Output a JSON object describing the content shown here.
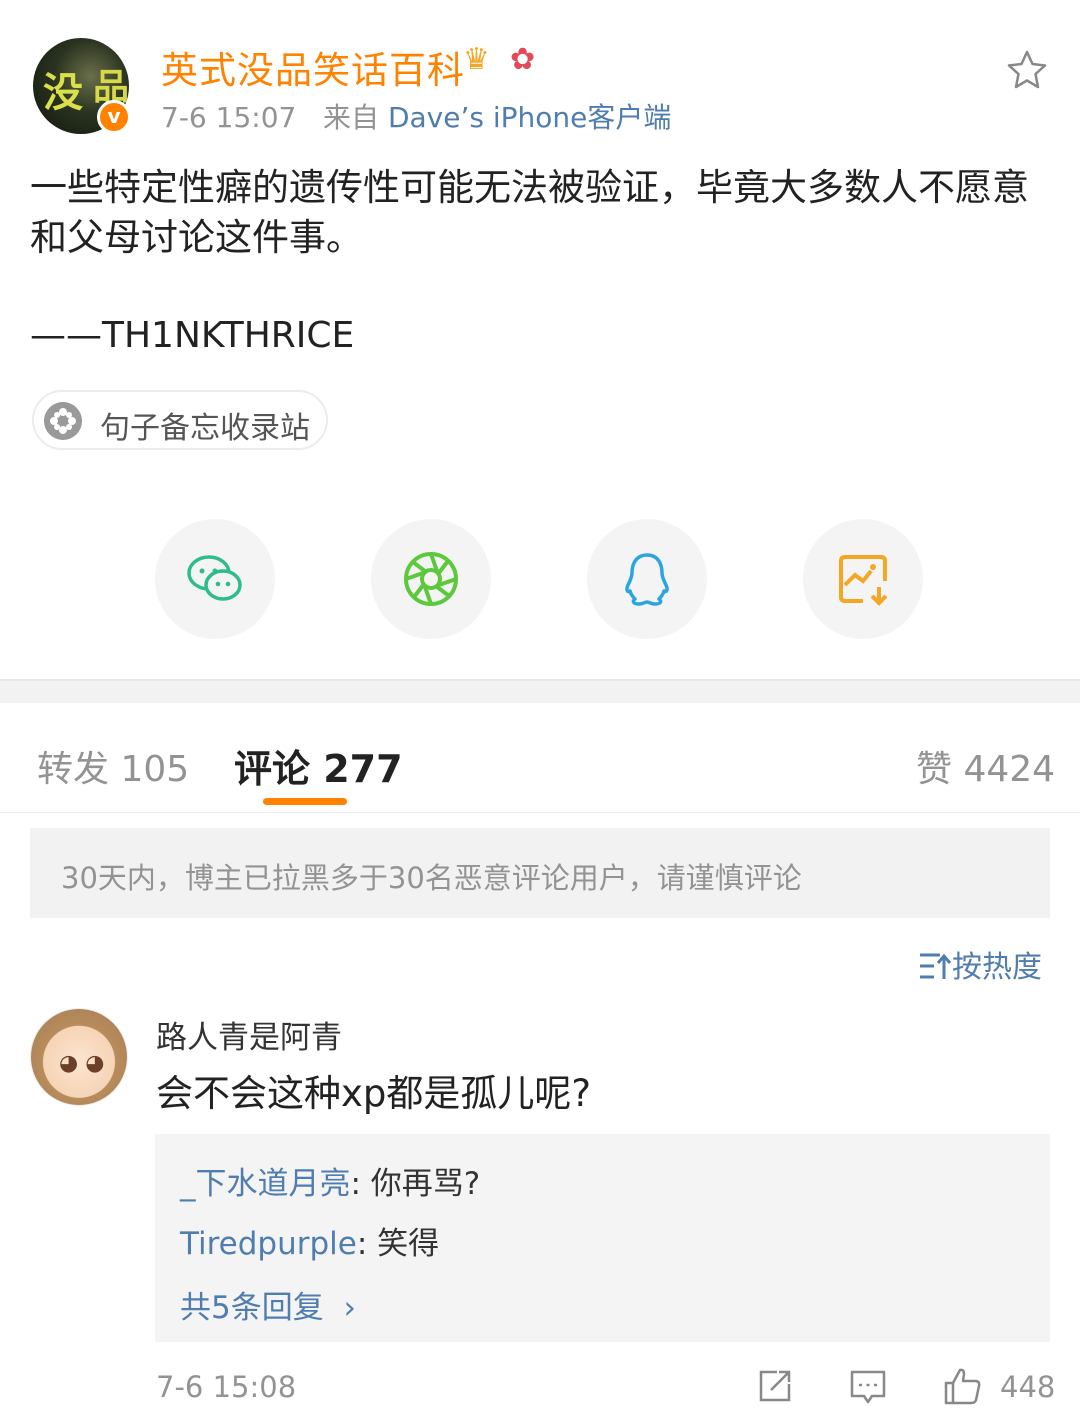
{
  "post": {
    "author": "英式没品笑话百科",
    "time": "7-6 15:07",
    "source_prefix": "来自",
    "source": "Dave’s iPhone客户端",
    "text": "一些特定性癖的遗传性可能无法被验证，毕竟大多数人不愿意和父母讨论这件事。",
    "signature": "——TH1NKTHRICE",
    "topic": "句子备忘收录站"
  },
  "share": [
    {
      "name": "wechat",
      "color": "#2dbd8a"
    },
    {
      "name": "moments",
      "color": "#5cc83b"
    },
    {
      "name": "qq",
      "color": "#2aa5e0"
    },
    {
      "name": "save-image",
      "color": "#f5a623"
    }
  ],
  "tabs": {
    "repost": "转发 105",
    "comments": "评论 277",
    "likes": "赞 4424"
  },
  "notice": "30天内，博主已拉黑多于30名恶意评论用户，请谨慎评论",
  "sort_label": "按热度",
  "comment": {
    "author": "路人青是阿青",
    "text": "会不会这种xp都是孤儿呢?",
    "replies": [
      {
        "name": "_下水道月亮",
        "text": ": 你再骂?"
      },
      {
        "name": "Tiredpurple",
        "text": ": 笑得"
      }
    ],
    "more_replies": "共5条回复",
    "time": "7-6 15:08",
    "likes": "448"
  },
  "colors": {
    "accent": "#ff8200",
    "link": "#507daf"
  }
}
